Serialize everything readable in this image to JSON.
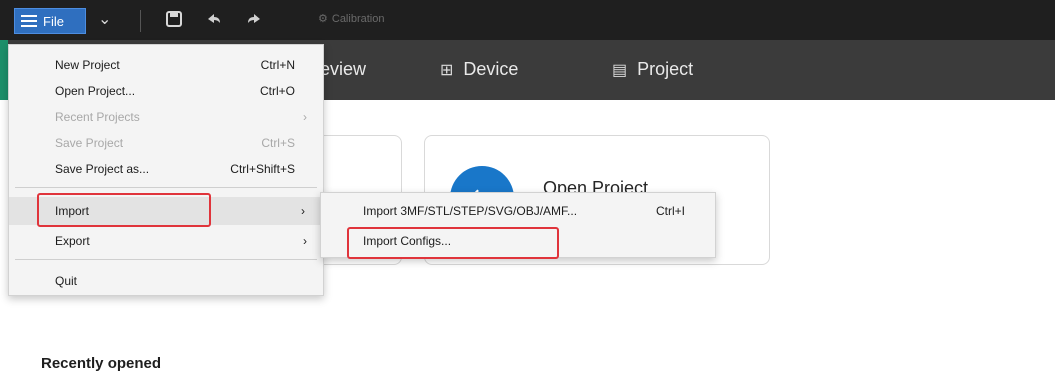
{
  "toolbar": {
    "file_label": "File",
    "calibration_label": "Calibration",
    "icons": [
      "menu-icon",
      "chevron-down-icon",
      "save-icon",
      "undo-icon",
      "redo-icon",
      "calibration-icon"
    ]
  },
  "tabs": [
    {
      "label": "eview",
      "icon": "preview-icon"
    },
    {
      "label": "Device",
      "icon": "device-icon"
    },
    {
      "label": "Project",
      "icon": "project-icon"
    }
  ],
  "home": {
    "open_project_label": "Open Project",
    "recently_opened": "Recently opened"
  },
  "file_menu": {
    "items": [
      {
        "label": "New Project",
        "shortcut": "Ctrl+N",
        "enabled": true
      },
      {
        "label": "Open Project...",
        "shortcut": "Ctrl+O",
        "enabled": true
      },
      {
        "label": "Recent Projects",
        "shortcut": "",
        "enabled": false,
        "submenu": true
      },
      {
        "label": "Save Project",
        "shortcut": "Ctrl+S",
        "enabled": false
      },
      {
        "label": "Save Project as...",
        "shortcut": "Ctrl+Shift+S",
        "enabled": true
      },
      {
        "label": "Import",
        "shortcut": "",
        "enabled": true,
        "submenu": true,
        "highlighted": true
      },
      {
        "label": "Export",
        "shortcut": "",
        "enabled": true,
        "submenu": true
      },
      {
        "label": "Quit",
        "shortcut": "",
        "enabled": true
      }
    ]
  },
  "import_submenu": {
    "items": [
      {
        "label": "Import 3MF/STL/STEP/SVG/OBJ/AMF...",
        "shortcut": "Ctrl+I"
      },
      {
        "label": "Import Configs...",
        "shortcut": "",
        "highlighted": true
      }
    ]
  },
  "colors": {
    "toolbar_bg": "#1f1f1f",
    "tabbar_bg": "#3b3b3b",
    "accent_blue": "#2f6fbf",
    "highlight_red": "#e0343b",
    "brand_green": "#1d8f6a"
  }
}
